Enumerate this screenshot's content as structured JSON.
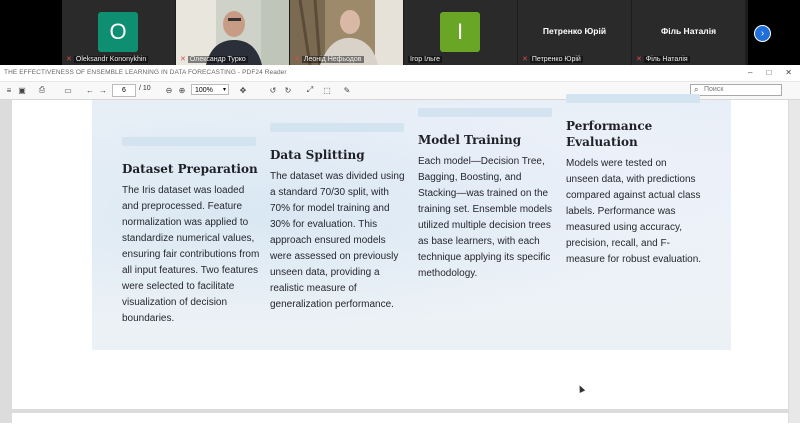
{
  "conference": {
    "participants": [
      {
        "name": "Oleksandr Kononykhin",
        "initial": "O",
        "type": "avatar",
        "color": "#0f8f72",
        "muted": true
      },
      {
        "name": "Олександр Турко",
        "type": "video",
        "active": true,
        "muted": true
      },
      {
        "name": "Леонід Нефьодов",
        "type": "video",
        "muted": true
      },
      {
        "name": "Ігор Ільге",
        "initial": "І",
        "type": "avatar",
        "color": "#6aa626",
        "muted": false
      },
      {
        "name": "Петренко Юрій",
        "type": "name-only",
        "muted": true
      },
      {
        "name": "Філь Наталія",
        "type": "name-only",
        "muted": true
      }
    ],
    "next_icon": "chevron-right-icon"
  },
  "viewer": {
    "title": "THE EFFECTIVENESS OF ENSEMBLE LEARNING IN DATA FORECASTING - PDF24 Reader",
    "page_current": "6",
    "page_total": "/ 10",
    "zoom": "100%",
    "search_placeholder": "Поиск"
  },
  "slide": {
    "columns": [
      {
        "heading": "Dataset Preparation",
        "body": "The Iris dataset was loaded and preprocessed. Feature normalization was applied to standardize numerical values, ensuring fair contributions from all input features. Two features were selected to facilitate visualization of decision boundaries."
      },
      {
        "heading": "Data Splitting",
        "body": "The dataset was divided using a standard 70/30 split, with 70% for model training and 30% for evaluation. This approach ensured models were assessed on previously unseen data, providing a realistic measure of generalization performance."
      },
      {
        "heading": "Model Training",
        "body": "Each model—Decision Tree, Bagging, Boosting, and Stacking—was trained on the training set. Ensemble models utilized multiple decision trees as base learners, with each technique applying its specific methodology."
      },
      {
        "heading": "Performance Evaluation",
        "body": "Models were tested on unseen data, with predictions compared against actual class labels. Performance was measured using accuracy, precision, recall, and F-measure for robust evaluation."
      }
    ]
  }
}
